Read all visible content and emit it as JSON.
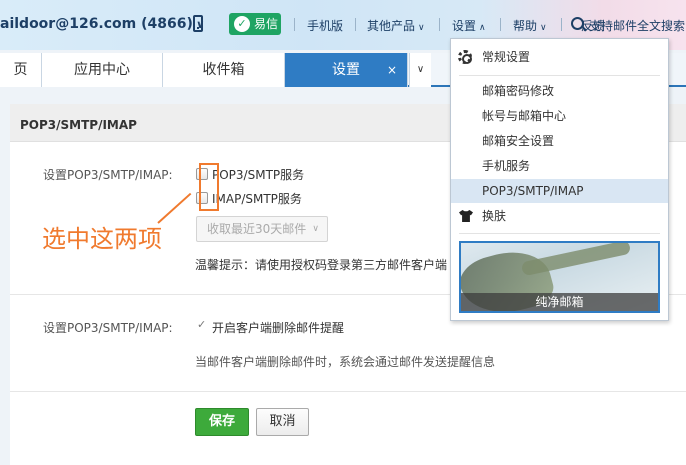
{
  "header": {
    "account": "aildoor@126.com (4866)",
    "yixin_label": "易信",
    "links": {
      "mobile": "手机版",
      "other_products": "其他产品",
      "settings": "设置",
      "help": "帮助",
      "feedback": "反馈",
      "fulltext_search": "支持邮件全文搜索"
    },
    "chevron": "∨"
  },
  "tabs": [
    {
      "label": "页"
    },
    {
      "label": "应用中心"
    },
    {
      "label": "收件箱"
    },
    {
      "label": "设置",
      "active": true
    }
  ],
  "tab_close": "×",
  "section": {
    "title": "POP3/SMTP/IMAP",
    "row1_label": "设置POP3/SMTP/IMAP:",
    "pop3_smtp": "POP3/SMTP服务",
    "imap_smtp": "IMAP/SMTP服务",
    "fetch_range": "收取最近30天邮件",
    "tip": "温馨提示：请使用授权码登录第三方邮件客户端",
    "row2_label": "设置POP3/SMTP/IMAP:",
    "delete_notice": "开启客户端删除邮件提醒",
    "delete_notice_checked": true,
    "note": "当邮件客户端删除邮件时，系统会通过邮件发送提醒信息"
  },
  "annotation": "选中这两项",
  "buttons": {
    "save": "保存",
    "cancel": "取消"
  },
  "settings_menu": {
    "general": "常规设置",
    "items": [
      "邮箱密码修改",
      "帐号与邮箱中心",
      "邮箱安全设置",
      "手机服务",
      "POP3/SMTP/IMAP"
    ],
    "selected": "POP3/SMTP/IMAP",
    "skin": "换肤",
    "theme_name": "纯净邮箱"
  },
  "colors": {
    "accent_blue": "#2f7cc4",
    "annotation_orange": "#f07a2e",
    "save_green": "#3daa3b",
    "yixin_green": "#1fa463"
  }
}
